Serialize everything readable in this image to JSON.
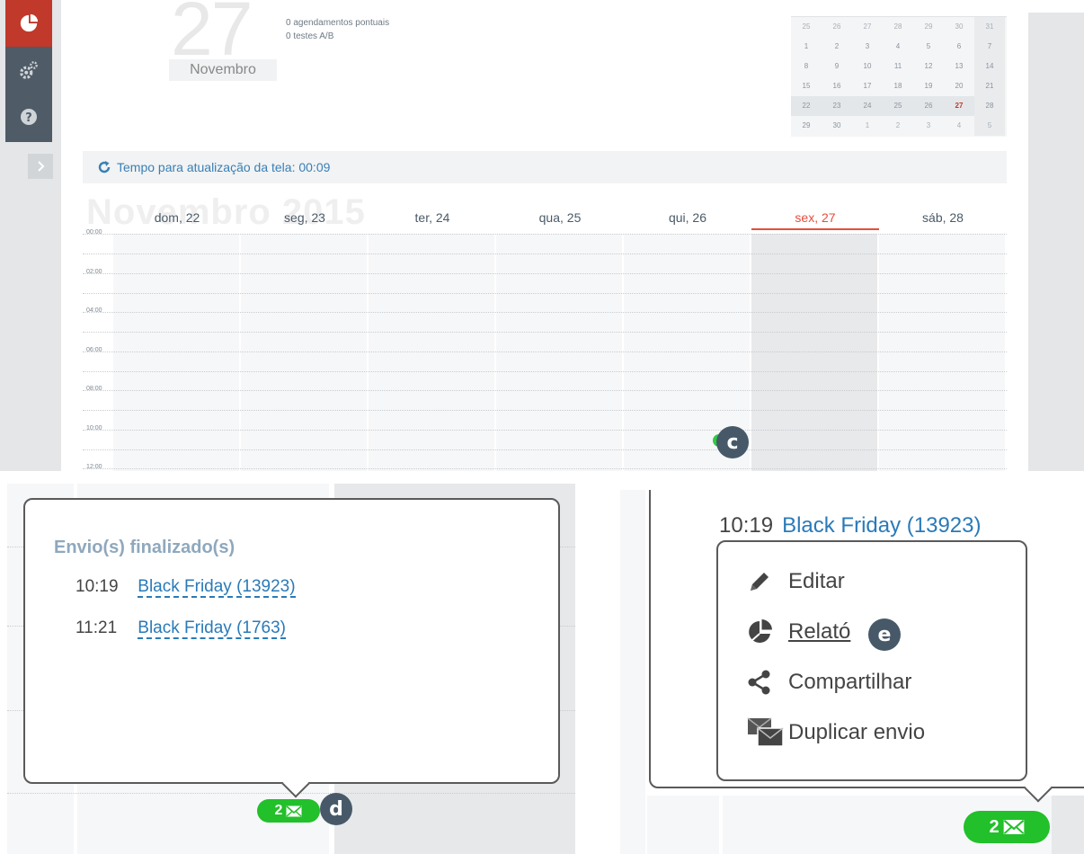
{
  "calendar_header": {
    "day_number": "27",
    "month": "Novembro",
    "summary": [
      "0 agendamentos pontuais",
      "0 testes A/B"
    ]
  },
  "mini_calendar": {
    "rows": [
      [
        "25",
        "26",
        "27",
        "28",
        "29",
        "30",
        "31"
      ],
      [
        "1",
        "2",
        "3",
        "4",
        "5",
        "6",
        "7"
      ],
      [
        "8",
        "9",
        "10",
        "11",
        "12",
        "13",
        "14"
      ],
      [
        "15",
        "16",
        "17",
        "18",
        "19",
        "20",
        "21"
      ],
      [
        "22",
        "23",
        "24",
        "25",
        "26",
        "27",
        "28"
      ],
      [
        "29",
        "30",
        "1",
        "2",
        "3",
        "4",
        "5"
      ]
    ],
    "today": "27"
  },
  "refresh": {
    "label": "Tempo para atualização da tela: 00:09"
  },
  "week": {
    "watermark": "Novembro 2015",
    "days": [
      "dom, 22",
      "seg, 23",
      "ter, 24",
      "qua, 25",
      "qui, 26",
      "sex, 27",
      "sáb, 28"
    ],
    "today_index": 5,
    "times": [
      "00:00",
      "02:00",
      "04:00",
      "06:00",
      "08:00",
      "10:00",
      "12:00"
    ]
  },
  "callouts": {
    "c": "c",
    "d": "d",
    "e": "e"
  },
  "popover_list": {
    "title": "Envio(s) finalizado(s)",
    "items": [
      {
        "time": "10:19",
        "name": "Black Friday (13923)"
      },
      {
        "time": "11:21",
        "name": "Black Friday (1763)"
      }
    ],
    "badge_count": "2"
  },
  "popover_menu": {
    "head_time": "10:19",
    "head_name": "Black Friday (13923)",
    "items": {
      "edit": "Editar",
      "report": "Relató",
      "share": "Compartilhar",
      "duplicate": "Duplicar envio"
    },
    "badge_count": "2"
  },
  "colors": {
    "brand_red": "#c0392b",
    "sidebar": "#4f5b66",
    "link_blue": "#2a7ab8",
    "today_red": "#e74c3c",
    "badge_green": "#22c02a",
    "callout": "#475969"
  },
  "icons": {
    "logo": "pie-chart-logo-icon",
    "settings": "gears-icon",
    "help": "question-icon",
    "expand": "chevron-right-icon",
    "refresh": "refresh-icon",
    "envelope": "envelope-icon",
    "edit": "pencil-icon",
    "report": "pie-chart-icon",
    "share": "share-icon",
    "duplicate": "duplicate-envelope-icon"
  }
}
